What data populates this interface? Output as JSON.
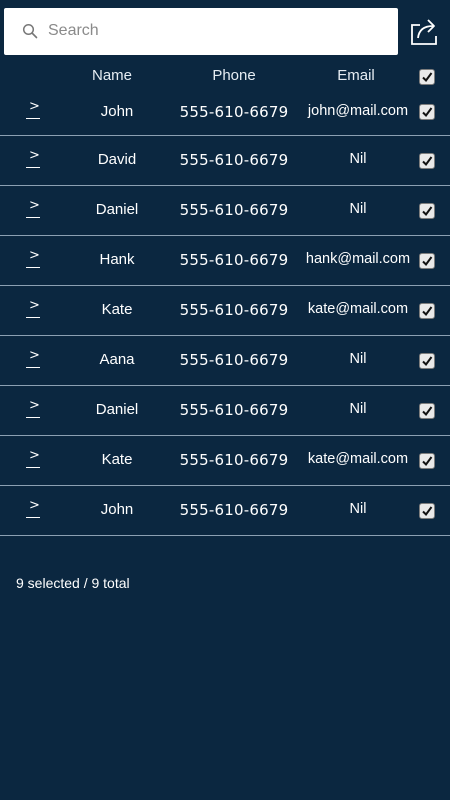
{
  "search": {
    "placeholder": "Search",
    "value": ""
  },
  "header": {
    "name": "Name",
    "phone": "Phone",
    "email": "Email",
    "select_all_checked": true
  },
  "rows": [
    {
      "name": "John",
      "phone": "555-610-6679",
      "email": "john@mail.com",
      "checked": true
    },
    {
      "name": "David",
      "phone": "555-610-6679",
      "email": "Nil",
      "checked": true
    },
    {
      "name": "Daniel",
      "phone": "555-610-6679",
      "email": "Nil",
      "checked": true
    },
    {
      "name": "Hank",
      "phone": "555-610-6679",
      "email": "hank@mail.com",
      "checked": true
    },
    {
      "name": "Kate",
      "phone": "555-610-6679",
      "email": "kate@mail.com",
      "checked": true
    },
    {
      "name": "Aana",
      "phone": "555-610-6679",
      "email": "Nil",
      "checked": true
    },
    {
      "name": "Daniel",
      "phone": "555-610-6679",
      "email": "Nil",
      "checked": true
    },
    {
      "name": "Kate",
      "phone": "555-610-6679",
      "email": "kate@mail.com",
      "checked": true
    },
    {
      "name": "John",
      "phone": "555-610-6679",
      "email": "Nil",
      "checked": true
    }
  ],
  "footer": {
    "selection_summary": "9 selected / 9 total"
  },
  "icons": {
    "search": "search-icon",
    "share": "share-icon",
    "expand": "chevron-right-icon",
    "check": "checkmark-icon"
  },
  "colors": {
    "background": "#0b2740",
    "text": "#ffffff",
    "divider": "#8ca0b3"
  }
}
